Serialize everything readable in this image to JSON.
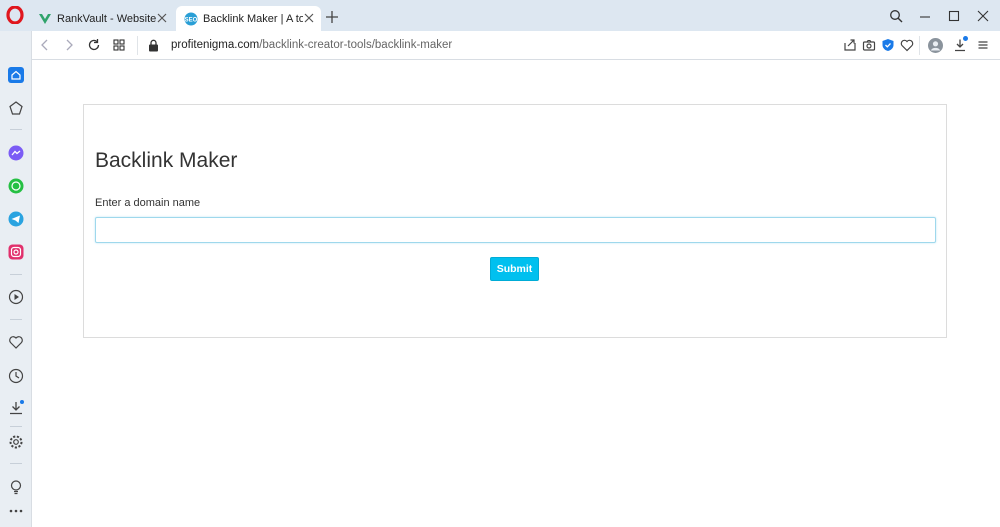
{
  "browser": {
    "tabs": [
      {
        "title": "RankVault - Website Analy",
        "favicon": "rankvault-v-icon",
        "active": false
      },
      {
        "title": "Backlink Maker | A to Z SEO",
        "favicon": "seo-badge-icon",
        "active": true
      }
    ],
    "address": {
      "domain": "profitenigma.com",
      "path": "/backlink-creator-tools/backlink-maker"
    },
    "sidebar_icons": [
      "home-icon",
      "bookmarks-icon",
      "messenger-icon",
      "whatsapp-icon",
      "telegram-icon",
      "instagram-icon",
      "player-icon",
      "heart-icon",
      "history-icon",
      "downloads-icon",
      "settings-icon",
      "lightbulb-icon",
      "more-icon"
    ],
    "accent": "#1a7ae8"
  },
  "page": {
    "title": "Backlink Maker",
    "field_label": "Enter a domain name",
    "input_value": "",
    "input_placeholder": "",
    "submit_label": "Submit",
    "button_color": "#00c0ef"
  }
}
